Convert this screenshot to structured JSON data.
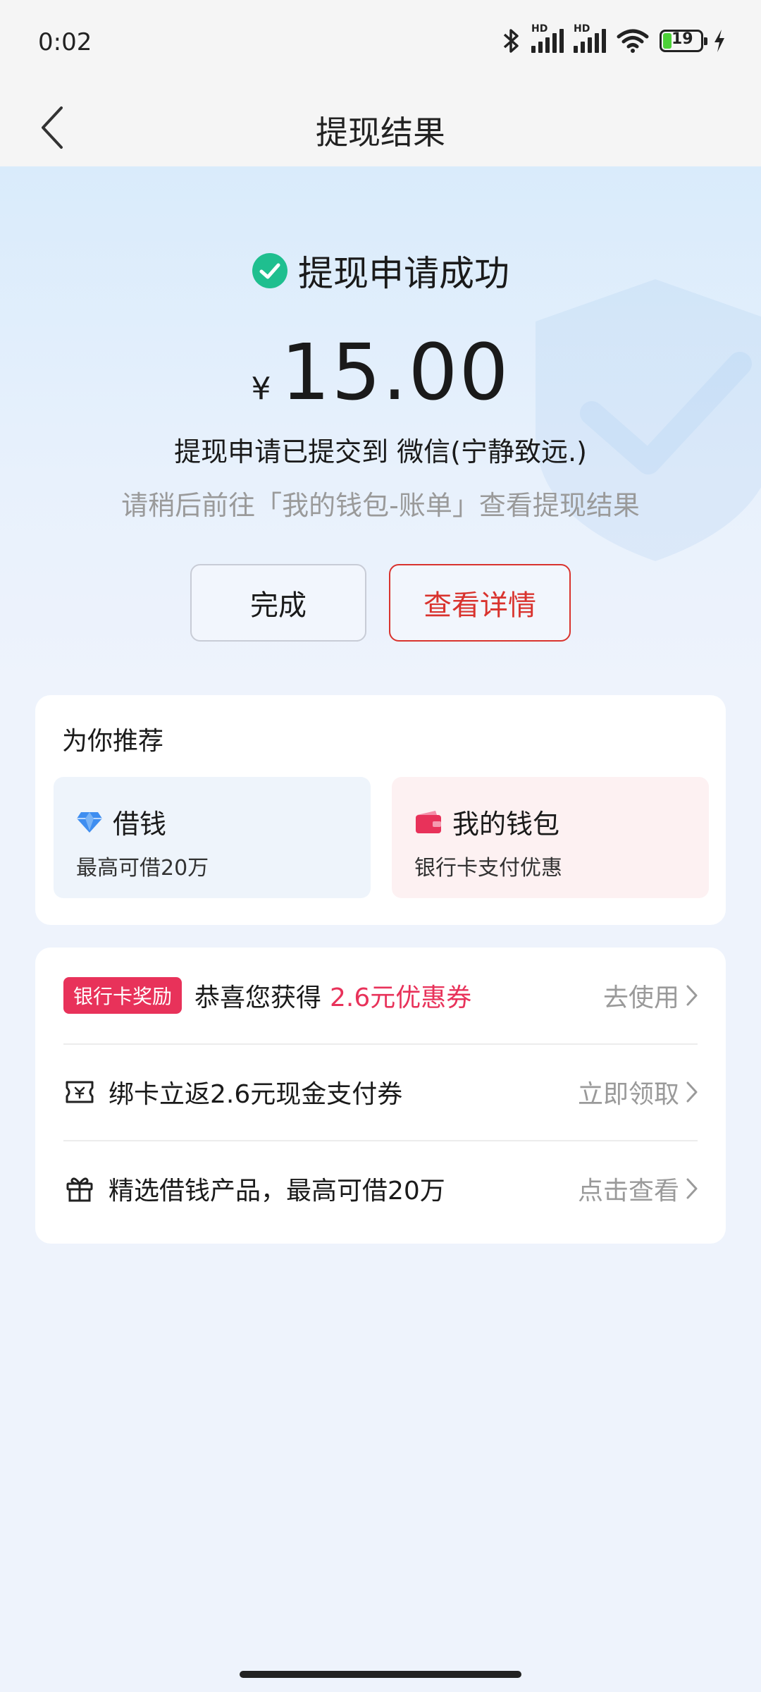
{
  "status_bar": {
    "time": "0:02",
    "battery": "19",
    "signal_labels": [
      "HD",
      "HD"
    ]
  },
  "nav": {
    "title": "提现结果"
  },
  "result": {
    "status_text": "提现申请成功",
    "currency": "¥",
    "amount": "15.00",
    "submitted_text": "提现申请已提交到 微信(宁静致远.)",
    "hint_text": "请稍后前往「我的钱包-账单」查看提现结果"
  },
  "buttons": {
    "done_label": "完成",
    "detail_label": "查看详情"
  },
  "recommend": {
    "title": "为你推荐",
    "items": [
      {
        "title": "借钱",
        "subtitle": "最高可借20万",
        "icon": "diamond-icon"
      },
      {
        "title": "我的钱包",
        "subtitle": "银行卡支付优惠",
        "icon": "wallet-icon"
      }
    ]
  },
  "offers": [
    {
      "badge": "银行卡奖励",
      "text": "恭喜您获得",
      "highlight": "2.6元优惠券",
      "action": "去使用",
      "icon": ""
    },
    {
      "badge": "",
      "text": "绑卡立返2.6元现金支付券",
      "highlight": "",
      "action": "立即领取",
      "icon": "ticket-icon"
    },
    {
      "badge": "",
      "text": "精选借钱产品，最高可借20万",
      "highlight": "",
      "action": "点击查看",
      "icon": "gift-icon"
    }
  ],
  "colors": {
    "success_green": "#1fbf8f",
    "primary_red": "#d9332e",
    "accent_pink": "#e8325a",
    "diamond_blue": "#3f8ef0"
  }
}
